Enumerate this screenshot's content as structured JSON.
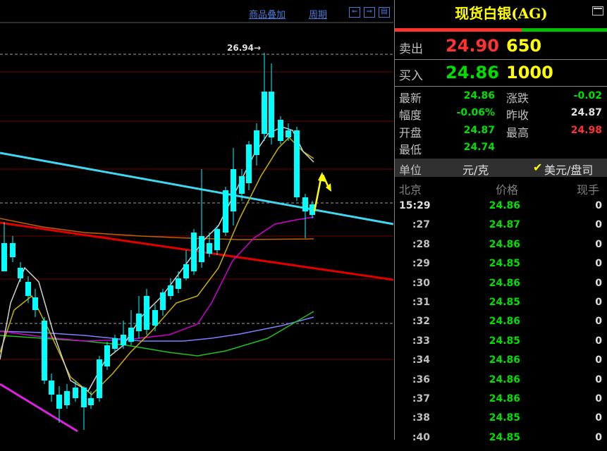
{
  "toolbar": {
    "overlay_label": "商品叠加",
    "period_label": "周期",
    "icons": [
      "nav-left-icon",
      "nav-right-icon",
      "layout-icon"
    ]
  },
  "chart": {
    "peak_label": "26.94→",
    "colors": {
      "up": "#ff3232",
      "down": "#00ffff",
      "cyan_line": "#40d8f0",
      "red_line": "#e00000",
      "ma_white": "#d0d0d0",
      "ma_yellow": "#c8b000",
      "ma_magenta": "#d000d0",
      "ma_green": "#20c020",
      "ma_orange": "#c06000",
      "ma_blue": "#8080ff",
      "arrow": "#ffff00"
    }
  },
  "panel": {
    "title": "现货白银(AG)",
    "sell_label": "卖出",
    "sell_price": "24.90",
    "sell_vol": "650",
    "buy_label": "买入",
    "buy_price": "24.86",
    "buy_vol": "1000",
    "stats": {
      "latest_label": "最新",
      "latest": "24.86",
      "change_label": "涨跌",
      "change": "-0.02",
      "pct_label": "幅度",
      "pct": "-0.06%",
      "prev_label": "昨收",
      "prev": "24.87",
      "open_label": "开盘",
      "open": "24.87",
      "high_label": "最高",
      "high": "24.98",
      "low_label": "最低",
      "low": "24.74"
    },
    "unit_label": "单位",
    "unit_value": "元/克",
    "unit_option": "美元/盘司",
    "tick_headers": {
      "time": "北京",
      "price": "价格",
      "vol": "现手"
    },
    "ticks": [
      {
        "time": "15:29",
        "price": "24.86",
        "vol": "0"
      },
      {
        "time": ":27",
        "price": "24.87",
        "vol": "0"
      },
      {
        "time": ":28",
        "price": "24.86",
        "vol": "0"
      },
      {
        "time": ":29",
        "price": "24.85",
        "vol": "0"
      },
      {
        "time": ":30",
        "price": "24.86",
        "vol": "0"
      },
      {
        "time": ":31",
        "price": "24.85",
        "vol": "0"
      },
      {
        "time": ":32",
        "price": "24.86",
        "vol": "0"
      },
      {
        "time": ":33",
        "price": "24.85",
        "vol": "0"
      },
      {
        "time": ":34",
        "price": "24.86",
        "vol": "0"
      },
      {
        "time": ":36",
        "price": "24.86",
        "vol": "0"
      },
      {
        "time": ":37",
        "price": "24.86",
        "vol": "0"
      },
      {
        "time": ":38",
        "price": "24.85",
        "vol": "0"
      },
      {
        "time": ":40",
        "price": "24.85",
        "vol": "0"
      }
    ]
  }
}
